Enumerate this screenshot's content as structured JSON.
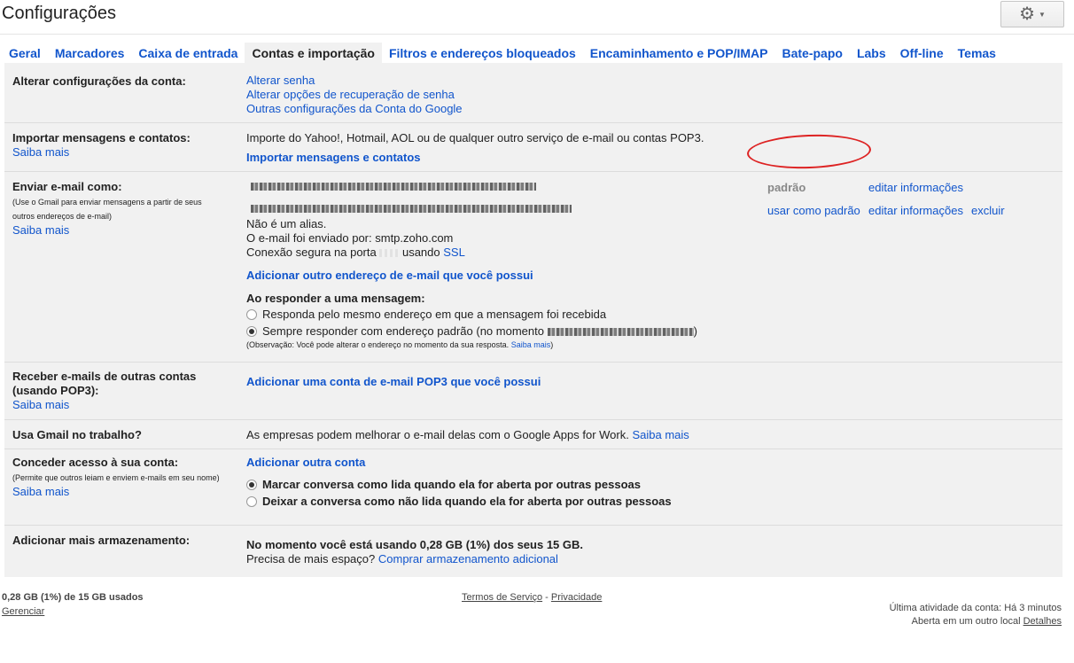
{
  "page_title": "Configurações",
  "tabs": [
    "Geral",
    "Marcadores",
    "Caixa de entrada",
    "Contas e importação",
    "Filtros e endereços bloqueados",
    "Encaminhamento e POP/IMAP",
    "Bate-papo",
    "Labs",
    "Off-line",
    "Temas"
  ],
  "sections": {
    "account": {
      "label": "Alterar configurações da conta:",
      "links": [
        "Alterar senha",
        "Alterar opções de recuperação de senha",
        "Outras configurações da Conta do Google"
      ]
    },
    "import": {
      "label": "Importar mensagens e contatos:",
      "learn": "Saiba mais",
      "desc": "Importe do Yahoo!, Hotmail, AOL ou de qualquer outro serviço de e-mail ou contas POP3.",
      "action": "Importar mensagens e contatos"
    },
    "send_as": {
      "label": "Enviar e-mail como:",
      "note": "(Use o Gmail para enviar mensagens a partir de seus outros endereços de e-mail)",
      "learn": "Saiba mais",
      "default_label": "padrão",
      "edit": "editar informações",
      "make_default": "usar como padrão",
      "delete": "excluir",
      "not_alias": "Não é um alias.",
      "sent_by": "O e-mail foi enviado por: smtp.zoho.com",
      "secure_prefix": "Conexão segura na porta",
      "secure_mid": "usando",
      "ssl": "SSL",
      "add_address": "Adicionar outro endereço de e-mail que você possui",
      "reply_heading": "Ao responder a uma mensagem:",
      "reply_same": "Responda pelo mesmo endereço em que a mensagem foi recebida",
      "reply_default_prefix": "Sempre responder com endereço padrão (no momento",
      "reply_default_suffix": ")",
      "obs_prefix": "(Observação: Você pode alterar o endereço no momento da sua resposta.",
      "obs_link": "Saiba mais",
      "obs_suffix": ")"
    },
    "pop3": {
      "label": "Receber e-mails de outras contas (usando POP3):",
      "learn": "Saiba mais",
      "action": "Adicionar uma conta de e-mail POP3 que você possui"
    },
    "work": {
      "label": "Usa Gmail no trabalho?",
      "desc": "As empresas podem melhorar o e-mail delas com o Google Apps for Work.",
      "learn": "Saiba mais"
    },
    "grant": {
      "label": "Conceder acesso à sua conta:",
      "note": "(Permite que outros leiam e enviem e-mails em seu nome)",
      "learn": "Saiba mais",
      "action": "Adicionar outra conta",
      "opt_read": "Marcar conversa como lida quando ela for aberta por outras pessoas",
      "opt_unread": "Deixar a conversa como não lida quando ela for aberta por outras pessoas"
    },
    "storage": {
      "label": "Adicionar mais armazenamento:",
      "usage": "No momento você está usando 0,28 GB (1%) dos seus 15 GB.",
      "need": "Precisa de mais espaço?",
      "buy": "Comprar armazenamento adicional"
    }
  },
  "footer": {
    "quota": "0,28 GB (1%) de 15 GB usados",
    "manage": "Gerenciar",
    "terms": "Termos de Serviço",
    "sep": "-",
    "privacy": "Privacidade",
    "last_activity": "Última atividade da conta: Há 3 minutos",
    "open_elsewhere": "Aberta em um outro local",
    "details": "Detalhes"
  },
  "colors": {
    "link": "#1155cc",
    "annotation": "#dd2222",
    "panel": "#f1f1f1"
  }
}
